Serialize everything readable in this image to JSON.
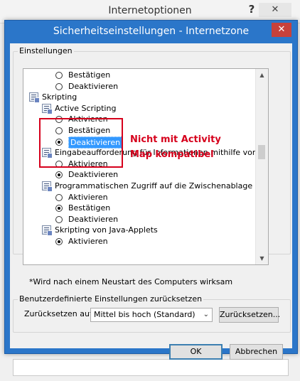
{
  "parent": {
    "title": "Internetoptionen",
    "help_label": "?",
    "close_label": "✕"
  },
  "dialog": {
    "title": "Sicherheitseinstellungen - Internetzone",
    "close_label": "✕",
    "settings_group_label": "Einstellungen",
    "note": "*Wird nach einem Neustart des Computers wirksam",
    "reset_group_label": "Benutzerdefinierte Einstellungen zurücksetzen",
    "reset_to_label": "Zurücksetzen auf:",
    "reset_select_value": "Mittel bis hoch (Standard)",
    "reset_button": "Zurücksetzen...",
    "ok_button": "OK",
    "cancel_button": "Abbrechen"
  },
  "settings_list": {
    "items": [
      {
        "type": "radio",
        "label": "Bestätigen",
        "checked": false
      },
      {
        "type": "radio",
        "label": "Deaktivieren",
        "checked": false
      },
      {
        "type": "category",
        "label": "Skripting"
      },
      {
        "type": "setting",
        "label": "Active Scripting"
      },
      {
        "type": "radio",
        "label": "Aktivieren",
        "checked": false
      },
      {
        "type": "radio",
        "label": "Bestätigen",
        "checked": false
      },
      {
        "type": "radio",
        "label": "Deaktivieren",
        "checked": true,
        "selected": true
      },
      {
        "type": "setting",
        "label": "Eingabeaufforderung für Informationen mithilfe von Skriptfen"
      },
      {
        "type": "radio",
        "label": "Aktivieren",
        "checked": false
      },
      {
        "type": "radio",
        "label": "Deaktivieren",
        "checked": true
      },
      {
        "type": "setting",
        "label": "Programmatischen Zugriff auf die Zwischenablage zulassen"
      },
      {
        "type": "radio",
        "label": "Aktivieren",
        "checked": false
      },
      {
        "type": "radio",
        "label": "Bestätigen",
        "checked": true
      },
      {
        "type": "radio",
        "label": "Deaktivieren",
        "checked": false
      },
      {
        "type": "setting",
        "label": "Skripting von Java-Applets"
      },
      {
        "type": "radio",
        "label": "Aktivieren",
        "checked": true
      }
    ]
  },
  "annotation": {
    "line1": "Nicht mit Activity",
    "line2": "Map kompatibel",
    "color": "#d6001c"
  }
}
